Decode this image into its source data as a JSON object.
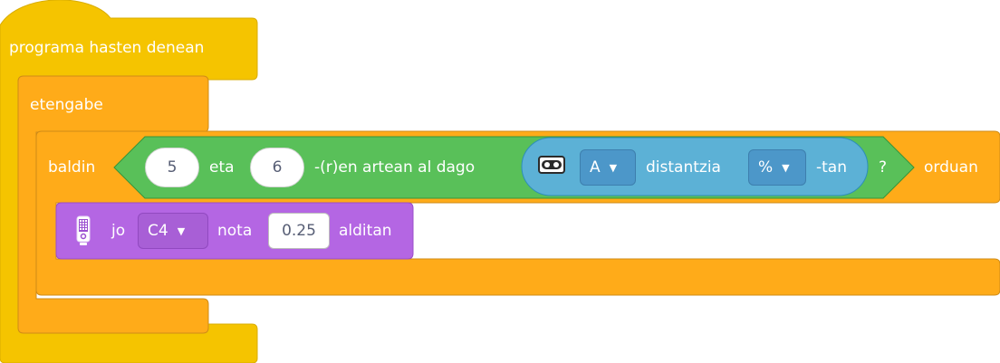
{
  "event": {
    "label": "programa hasten denean"
  },
  "forever": {
    "label": "etengabe"
  },
  "if_block": {
    "prefix": "baldin",
    "suffix": "orduan",
    "condition": {
      "min_value": "5",
      "and_label": "eta",
      "max_value": "6",
      "between_label": "-(r)en artean al dago",
      "question_mark": "?",
      "sensor": {
        "icon": "distance-sensor-icon",
        "port": "A",
        "label": "distantzia",
        "unit": "%",
        "unit_suffix": "-tan"
      }
    }
  },
  "play_note": {
    "icon": "hub-icon",
    "verb": "jo",
    "note": "C4",
    "note_label": "nota",
    "duration": "0.25",
    "duration_label": "alditan"
  },
  "colors": {
    "event": "#f5c400",
    "control": "#ffab19",
    "operator": "#59c059",
    "sensor": "#5cb1d6",
    "sound": "#b466e3"
  }
}
